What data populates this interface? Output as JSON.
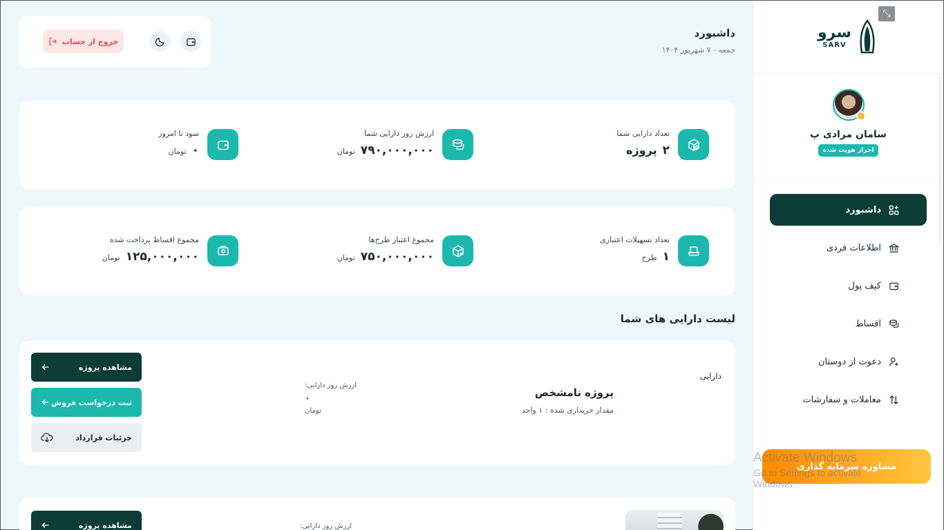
{
  "sidebar": {
    "logo": {
      "fa": "سرو",
      "en": "SARV"
    },
    "collapse_icon": "⤡",
    "user": {
      "name": "سامان مرادی پ",
      "badge": "احراز هویت شده"
    },
    "nav": [
      {
        "label": "داشبورد",
        "icon": "dashboard-icon",
        "active": true
      },
      {
        "label": "اطلاعات فردی",
        "icon": "bank-icon",
        "active": false
      },
      {
        "label": "کیف پول",
        "icon": "wallet-icon",
        "active": false
      },
      {
        "label": "اقساط",
        "icon": "coins-icon",
        "active": false
      },
      {
        "label": "دعوت از دوستان",
        "icon": "user-add-icon",
        "active": false
      },
      {
        "label": "معاملات و سفارشات",
        "icon": "sort-icon",
        "active": false
      }
    ],
    "consult_button": "مشاوره سرمایه گذاری"
  },
  "overlay": {
    "line1": "Activate Windows",
    "line2": "Go to Settings to activate Windows."
  },
  "header": {
    "title": "داشبورد",
    "date": "جمعه - ۷ شهریور ۱۴۰۴",
    "logout": "خروج از حساب"
  },
  "stats_row1": [
    {
      "label": "تعداد دارایی شما",
      "value": "۲",
      "unit": "پروژه",
      "icon": "box-check-icon"
    },
    {
      "label": "ارزش روز دارایی شما",
      "value": "۷۹۰,۰۰۰,۰۰۰",
      "unit": "تومان",
      "icon": "coins-icon"
    },
    {
      "label": "سود تا امروز",
      "value": "۰",
      "unit": "تومان",
      "icon": "wallet-icon"
    }
  ],
  "stats_row2": [
    {
      "label": "تعداد تسهیلات اعتباری",
      "value": "۱",
      "unit": "طرح",
      "icon": "card-icon"
    },
    {
      "label": "مجموع اعتبار طرح‌ها",
      "value": "۷۵۰,۰۰۰,۰۰۰",
      "unit": "تومان",
      "icon": "box-plus-icon"
    },
    {
      "label": "مجموع اقساط پرداخت شده",
      "value": "۱۲۵,۰۰۰,۰۰۰",
      "unit": "تومان",
      "icon": "money-icon"
    }
  ],
  "assets": {
    "title": "لیست دارایی های شما",
    "items": [
      {
        "tag": "دارایی",
        "name": "پروژه نامشخص",
        "qty": "مقدار خریداری شده : ۱ واحد",
        "value_label": "ارزش روز دارایی:",
        "value": "۰",
        "value_unit": "تومان",
        "btn_view": "مشاهده پروژه",
        "btn_sell": "ثبت درخواست فروش",
        "btn_contract": "جزئیات قرارداد"
      },
      {
        "value_label": "ارزش روز دارایی:",
        "btn_view": "مشاهده پروژه"
      }
    ]
  }
}
